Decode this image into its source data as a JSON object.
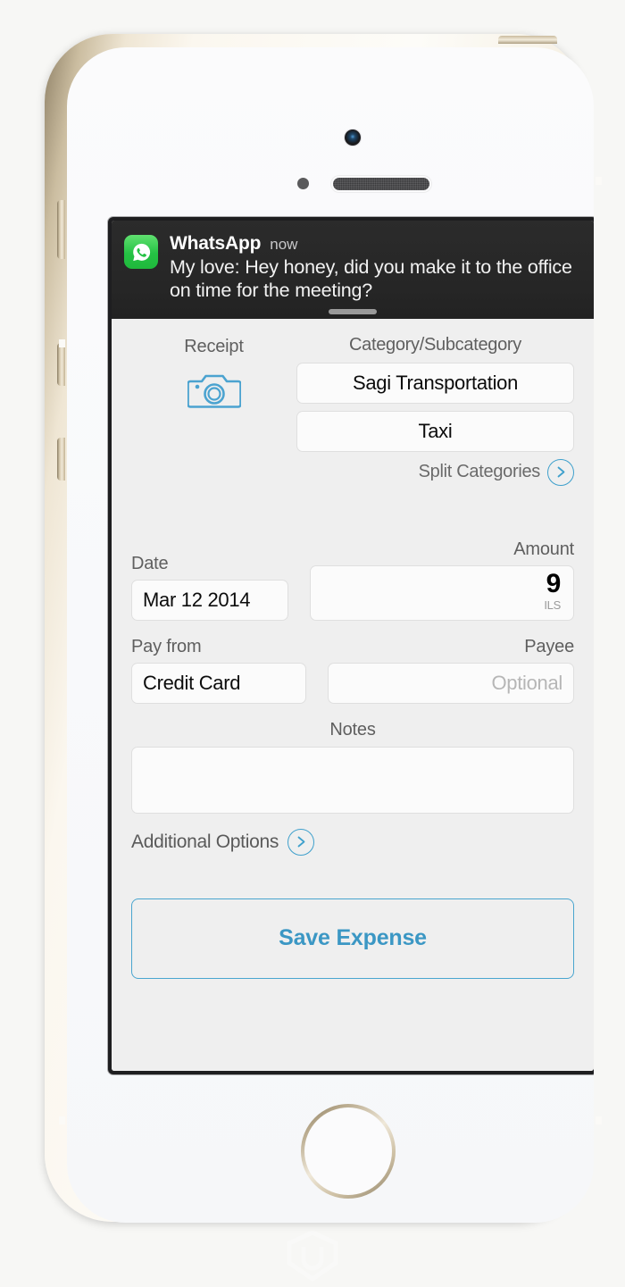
{
  "device": {
    "name": "iPhone 5s Gold",
    "icons": {
      "front_camera": "camera-icon",
      "proximity_sensor": "proximity-sensor-icon",
      "earpiece_speaker": "speaker-grille-icon",
      "home_button": "home-button-icon",
      "mute_switch": "mute-switch-button",
      "volume_up": "volume-up-button",
      "volume_down": "volume-down-button",
      "power": "power-button"
    }
  },
  "notification": {
    "app_icon": "whatsapp-icon",
    "app_name": "WhatsApp",
    "time": "now",
    "message": "My love: Hey honey, did you make it to the office on time for the meeting?",
    "grabber": "drag-grabber",
    "background_color": "#262626"
  },
  "form": {
    "receipt": {
      "label": "Receipt",
      "icon": "camera-icon"
    },
    "category": {
      "label": "Category/Subcategory",
      "category_value": "Sagi Transportation",
      "subcategory_value": "Taxi",
      "split_label": "Split Categories",
      "split_icon": "chevron-right-circle-icon"
    },
    "date": {
      "label": "Date",
      "value": "Mar 12 2014"
    },
    "amount": {
      "label": "Amount",
      "value": "9",
      "currency": "ILS"
    },
    "pay_from": {
      "label": "Pay from",
      "value": "Credit Card"
    },
    "payee": {
      "label": "Payee",
      "placeholder": "Optional",
      "value": ""
    },
    "notes": {
      "label": "Notes",
      "value": "",
      "placeholder": ""
    },
    "additional_options": {
      "label": "Additional Options",
      "icon": "chevron-right-circle-icon"
    },
    "save": {
      "label": "Save Expense"
    }
  },
  "colors": {
    "accent_blue": "#3fa0cc",
    "save_text": "#3b97c4",
    "app_background": "#efefef",
    "whatsapp_green": "#25c244"
  }
}
